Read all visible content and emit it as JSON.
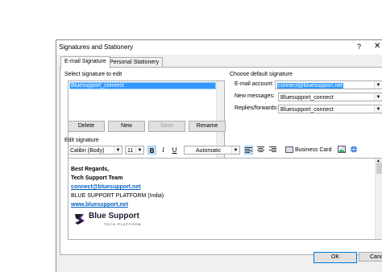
{
  "window": {
    "title": "Signatures and Stationery",
    "help_glyph": "?",
    "close_glyph": "✕"
  },
  "tabs": [
    {
      "label": "E-mail Signature",
      "active": true
    },
    {
      "label": "Personal Stationery",
      "active": false
    }
  ],
  "select_signature": {
    "label": "Select signature to edit",
    "items": [
      "Bluesupport_connect"
    ],
    "selected": "Bluesupport_connect"
  },
  "buttons": {
    "delete": "Delete",
    "new": "New",
    "save": "Save",
    "rename": "Rename",
    "ok": "OK",
    "cancel": "Cancel"
  },
  "default_signature": {
    "label": "Choose default signature",
    "email_account_label": "E-mail account:",
    "email_account_value": "connect@bluesupport.net",
    "new_messages_label": "New messages:",
    "new_messages_value": "Bluesupport_connect",
    "replies_label": "Replies/forwards:",
    "replies_value": "Bluesupport_connect"
  },
  "edit_signature": {
    "label": "Edit signature",
    "font": "Calibri (Body)",
    "size": "11",
    "color": "Automatic",
    "business_card": "Business Card",
    "bold_glyph": "B",
    "italic_glyph": "I",
    "underline_glyph": "U"
  },
  "signature_body": {
    "line1": "Best Regards,",
    "line2": "Tech Support Team",
    "email": "connect@bluesupport.net",
    "line4": "BLUE SUPPORT PLATFORM (India)",
    "website": "www.bluesupport.net",
    "logo_text": "Blue Support",
    "logo_subtext": "TECH PLATFORM"
  },
  "colors": {
    "accent": "#0078d7",
    "selection": "#3399ff",
    "link": "#0563c1",
    "logo_purple": "#5b2d8c"
  }
}
